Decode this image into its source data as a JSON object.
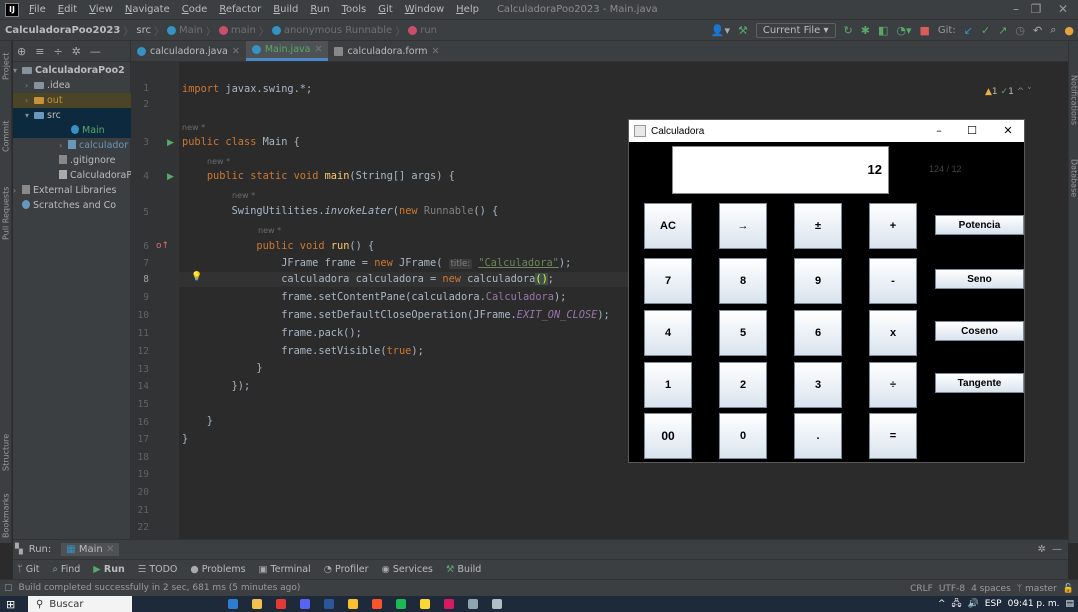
{
  "menubar": {
    "items": [
      "File",
      "Edit",
      "View",
      "Navigate",
      "Code",
      "Refactor",
      "Build",
      "Run",
      "Tools",
      "Git",
      "Window",
      "Help"
    ],
    "window_title": "CalculadoraPoo2023 - Main.java"
  },
  "navbar": {
    "crumbs": [
      "CalculadoraPoo2023",
      "src",
      "Main",
      "main",
      "anonymous Runnable",
      "run"
    ],
    "current_file": "Current File",
    "git_label": "Git:"
  },
  "sidebar": {
    "project_tab": "Project",
    "commit_tab": "Commit",
    "pull_requests_tab": "Pull Requests",
    "structure_tab": "Structure",
    "bookmarks_tab": "Bookmarks"
  },
  "rightbar": {
    "notifications_tab": "Notifications",
    "database_tab": "Database"
  },
  "project": {
    "items": [
      {
        "label": "CalculadoraPoo2",
        "indent": 0
      },
      {
        "label": ".idea",
        "indent": 1
      },
      {
        "label": "out",
        "indent": 1
      },
      {
        "label": "src",
        "indent": 1
      },
      {
        "label": "Main",
        "indent": 2
      },
      {
        "label": "calculador",
        "indent": 2
      },
      {
        "label": ".gitignore",
        "indent": 1
      },
      {
        "label": "CalculadoraPo",
        "indent": 1
      },
      {
        "label": "External Libraries",
        "indent": 0
      },
      {
        "label": "Scratches and Co",
        "indent": 0
      }
    ]
  },
  "tabs": [
    {
      "label": "calculadora.java"
    },
    {
      "label": "Main.java"
    },
    {
      "label": "calculadora.form"
    }
  ],
  "editor": {
    "warnings": "1",
    "checks": "1",
    "hint_new": "new *",
    "param_title": "title:",
    "lines": [
      "1",
      "2",
      "3",
      "4",
      "5",
      "6",
      "7",
      "8",
      "9",
      "10",
      "11",
      "12",
      "13",
      "14",
      "15",
      "16",
      "17",
      "18",
      "19",
      "20",
      "21",
      "22"
    ]
  },
  "calc_window": {
    "title": "Calculadora",
    "display": "12",
    "subdisplay": "124 / 12",
    "buttons": [
      [
        "AC",
        "→",
        "±",
        "+"
      ],
      [
        "7",
        "8",
        "9",
        "-"
      ],
      [
        "4",
        "5",
        "6",
        "x"
      ],
      [
        "1",
        "2",
        "3",
        "÷"
      ],
      [
        "00",
        "0",
        ".",
        "="
      ]
    ],
    "functions": [
      "Potencia",
      "Seno",
      "Coseno",
      "Tangente"
    ]
  },
  "runbar": {
    "label": "Run:",
    "config": "Main"
  },
  "bottom_tools": [
    "Git",
    "Find",
    "Run",
    "TODO",
    "Problems",
    "Terminal",
    "Profiler",
    "Services",
    "Build"
  ],
  "status": {
    "message": "Build completed successfully in 2 sec, 681 ms (5 minutes ago)",
    "line_sep": "CRLF",
    "encoding": "UTF-8",
    "indent": "4 spaces",
    "branch": "master"
  },
  "taskbar": {
    "search_placeholder": "Buscar",
    "lang": "ESP",
    "time": "09:41 p. m."
  }
}
